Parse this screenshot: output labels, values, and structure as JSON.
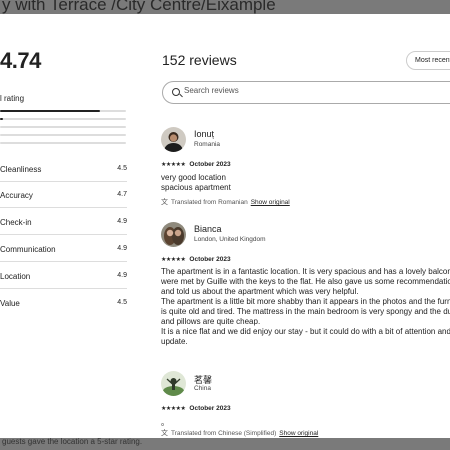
{
  "page": {
    "bg_title": "y with Terrace /City Centre/Eixample",
    "bg_footer": "guests gave the location a 5-star rating."
  },
  "left": {
    "overall_value": "4.74",
    "overall_label": "l rating",
    "distribution": [
      0.79,
      0.02,
      0,
      0,
      0
    ],
    "categories": [
      {
        "name": "Cleanliness",
        "value": "4.5"
      },
      {
        "name": "Accuracy",
        "value": "4.7"
      },
      {
        "name": "Check-in",
        "value": "4.9"
      },
      {
        "name": "Communication",
        "value": "4.9"
      },
      {
        "name": "Location",
        "value": "4.9"
      },
      {
        "name": "Value",
        "value": "4.5"
      }
    ]
  },
  "right": {
    "reviews_count": "152 reviews",
    "sort_label": "Most recent",
    "search_placeholder": "Search reviews",
    "reviews": [
      {
        "name": "Ionuț",
        "location": "Romania",
        "stars": "★★★★★",
        "date": "October 2023",
        "body": [
          "very good location",
          "spacious apartment"
        ],
        "translated": "Translated from Romanian",
        "show_original": "Show original"
      },
      {
        "name": "Bianca",
        "location": "London, United Kingdom",
        "stars": "★★★★★",
        "date": "October 2023",
        "body": [
          "The apartment is in a fantastic location. It is very spacious and has a lovely balcony. W",
          "were met by Guille with the keys to the flat. He also gave us some recommendation",
          "and told us about the apartment which was very helpful.",
          "The apartment is a little bit more shabby than it appears in the photos and the furni",
          "is quite old and tired. The mattress in the main bedroom is very spongy and the duv",
          "and pillows are quite cheap.",
          "It is a nice flat and we did enjoy our stay - but it could do with a bit of attention and",
          "update."
        ]
      },
      {
        "name": "茗馨",
        "location": "China",
        "stars": "★★★★★",
        "date": "October 2023",
        "body": [
          "。"
        ],
        "translated": "Translated from Chinese (Simplified)",
        "show_original": "Show original"
      }
    ]
  },
  "colors": {
    "accent": "#222222",
    "divider": "#dddddd",
    "overlay": "#7a7a7a"
  },
  "icons": [
    "search-icon",
    "translate-icon",
    "star-icon"
  ]
}
